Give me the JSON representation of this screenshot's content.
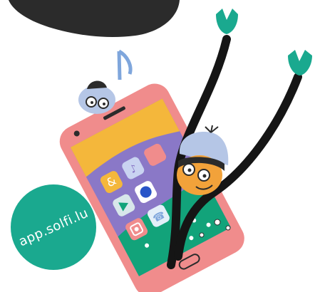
{
  "badge": {
    "text": "app.solfi.lu"
  },
  "illustration": {
    "icons": [
      "music-note-icon",
      "ampersand-icon",
      "play-icon",
      "camera-icon",
      "notification-icon",
      "phone-icon",
      "circle-app-icon",
      "wifi-icon"
    ],
    "colors": {
      "badge": "#1aa98f",
      "phone_frame": "#f08c8c",
      "screen_top": "#f4b73b",
      "screen_mid": "#8a78c7",
      "screen_bottom": "#12a37a",
      "limbs": "#151515",
      "hands": "#1aa98f",
      "blob": "#2b2b2b",
      "hat": "#b5c6e6",
      "face": "#f2a23a"
    }
  }
}
